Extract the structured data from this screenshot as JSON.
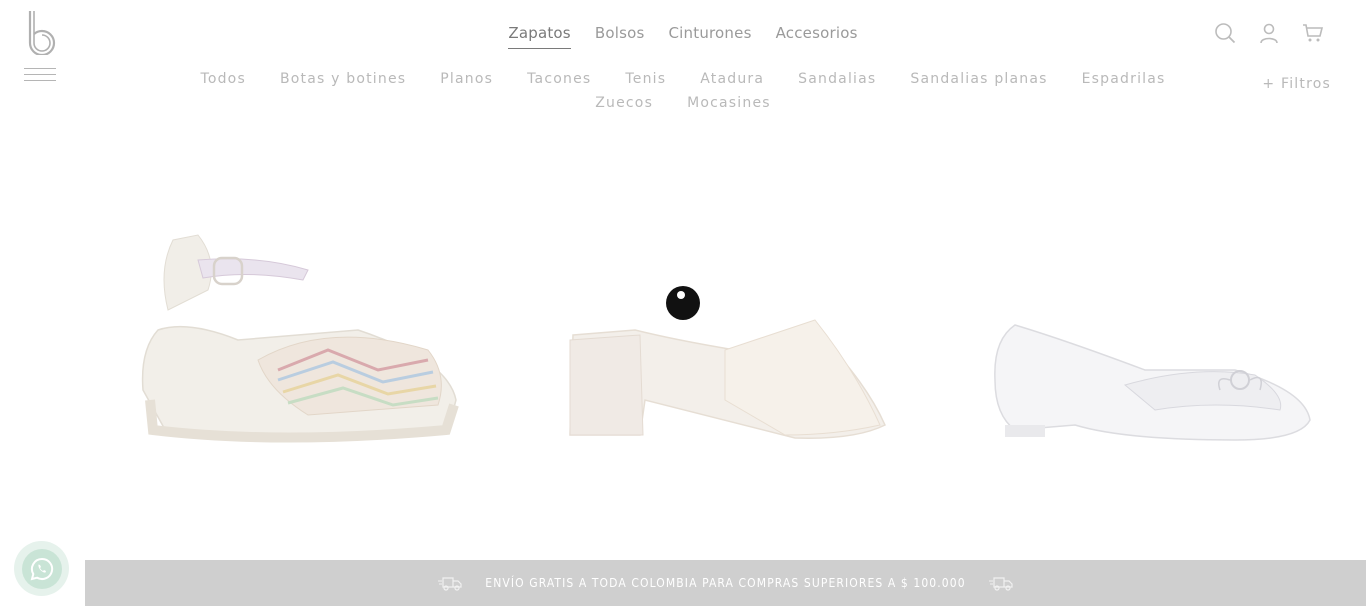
{
  "header": {
    "logo_letter": "b",
    "categories": [
      {
        "label": "Zapatos",
        "active": true
      },
      {
        "label": "Bolsos",
        "active": false
      },
      {
        "label": "Cinturones",
        "active": false
      },
      {
        "label": "Accesorios",
        "active": false
      }
    ],
    "icons": [
      "search-icon",
      "user-icon",
      "cart-icon"
    ]
  },
  "subcategories": [
    "Todos",
    "Botas y botines",
    "Planos",
    "Tacones",
    "Tenis",
    "Atadura",
    "Sandalias",
    "Sandalias planas",
    "Espadrilas",
    "Zuecos",
    "Mocasines"
  ],
  "filters": {
    "label": "+ Filtros"
  },
  "products": [
    {
      "name": "espadrille-wedge",
      "image": "striped espadrille wedge sandal"
    },
    {
      "name": "block-heel-mule",
      "image": "cream block heel mule"
    },
    {
      "name": "ballet-flat",
      "image": "white ballet flat with bow"
    }
  ],
  "promo": {
    "text": "ENVÍO GRATIS A TODA COLOMBIA PARA COMPRAS SUPERIORES A $ 100.000"
  },
  "colors": {
    "promo_bg": "#cfcfcf",
    "nav_text": "#9a9a9a",
    "subnav_text": "#b9b9b9",
    "whatsapp": "#c9e4d6"
  }
}
